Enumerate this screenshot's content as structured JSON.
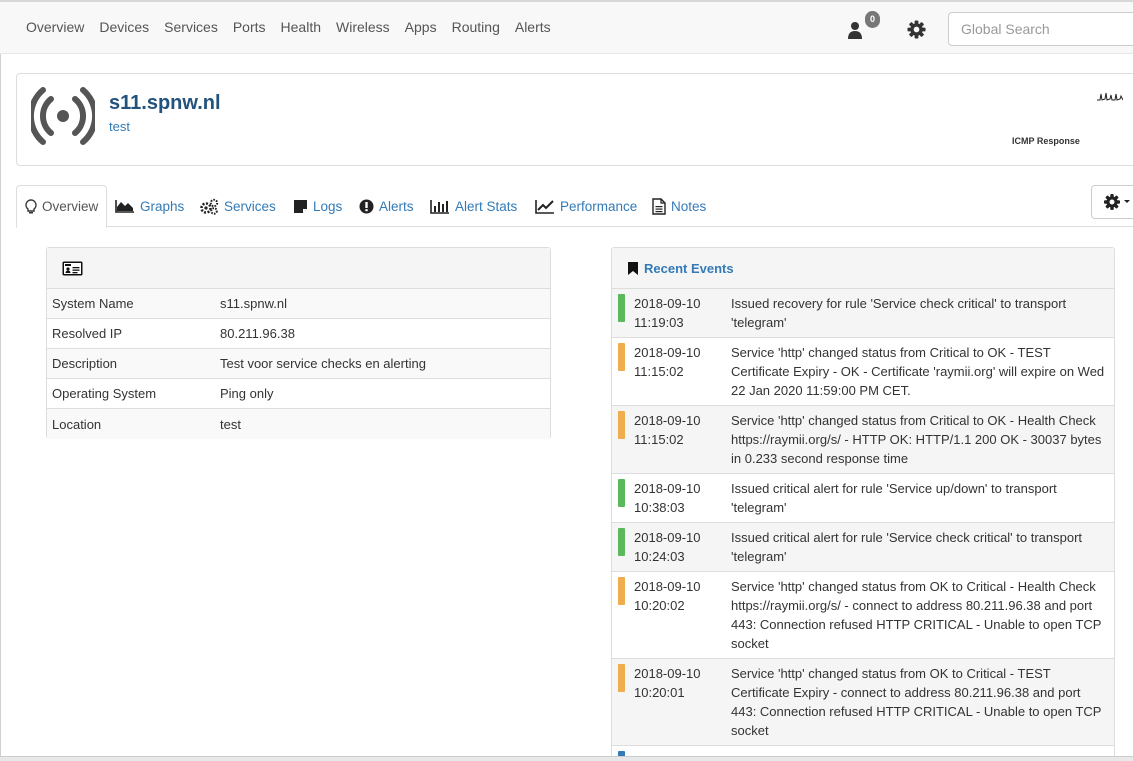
{
  "nav": {
    "items": [
      "Overview",
      "Devices",
      "Services",
      "Ports",
      "Health",
      "Wireless",
      "Apps",
      "Routing",
      "Alerts"
    ],
    "notification_count": "0",
    "search_placeholder": "Global Search"
  },
  "device": {
    "hostname": "s11.spnw.nl",
    "location": "test",
    "graph_label": "ICMP Response"
  },
  "tabs": [
    {
      "label": "Overview",
      "icon": "lightbulb-icon",
      "active": true
    },
    {
      "label": "Graphs",
      "icon": "area-chart-icon"
    },
    {
      "label": "Services",
      "icon": "cogs-icon"
    },
    {
      "label": "Logs",
      "icon": "sticky-note-icon"
    },
    {
      "label": "Alerts",
      "icon": "exclamation-circle-icon"
    },
    {
      "label": "Alert Stats",
      "icon": "bar-chart-icon"
    },
    {
      "label": "Performance",
      "icon": "line-chart-icon"
    },
    {
      "label": "Notes",
      "icon": "file-text-icon"
    }
  ],
  "overview": {
    "header_icon": "id-card-icon",
    "rows": [
      {
        "key": "System Name",
        "value": "s11.spnw.nl"
      },
      {
        "key": "Resolved IP",
        "value": "80.211.96.38"
      },
      {
        "key": "Description",
        "value": "Test voor service checks en alerting"
      },
      {
        "key": "Operating System",
        "value": "Ping only"
      },
      {
        "key": "Location",
        "value": "test"
      }
    ]
  },
  "events": {
    "title": "Recent Events",
    "items": [
      {
        "date": "2018-09-10",
        "time": "11:19:03",
        "severity_color": "#5cb85c",
        "message": "Issued recovery for rule 'Service check critical' to transport 'telegram'"
      },
      {
        "date": "2018-09-10",
        "time": "11:15:02",
        "severity_color": "#f0ad4e",
        "message": "Service 'http' changed status from Critical to OK - TEST Certificate Expiry - OK - Certificate 'raymii.org' will expire on Wed 22 Jan 2020 11:59:00 PM CET."
      },
      {
        "date": "2018-09-10",
        "time": "11:15:02",
        "severity_color": "#f0ad4e",
        "message": "Service 'http' changed status from Critical to OK - Health Check https://raymii.org/s/ - HTTP OK: HTTP/1.1 200 OK - 30037 bytes in 0.233 second response time"
      },
      {
        "date": "2018-09-10",
        "time": "10:38:03",
        "severity_color": "#5cb85c",
        "message": "Issued critical alert for rule 'Service up/down' to transport 'telegram'"
      },
      {
        "date": "2018-09-10",
        "time": "10:24:03",
        "severity_color": "#5cb85c",
        "message": "Issued critical alert for rule 'Service check critical' to transport 'telegram'"
      },
      {
        "date": "2018-09-10",
        "time": "10:20:02",
        "severity_color": "#f0ad4e",
        "message": "Service 'http' changed status from OK to Critical - Health Check https://raymii.org/s/ - connect to address 80.211.96.38 and port 443: Connection refused HTTP CRITICAL - Unable to open TCP socket"
      },
      {
        "date": "2018-09-10",
        "time": "10:20:01",
        "severity_color": "#f0ad4e",
        "message": "Service 'http' changed status from OK to Critical - TEST Certificate Expiry - connect to address 80.211.96.38 and port 443: Connection refused HTTP CRITICAL - Unable to open TCP socket"
      },
      {
        "date": "",
        "time": "",
        "severity_color": "#337ab7",
        "message": ""
      }
    ]
  }
}
